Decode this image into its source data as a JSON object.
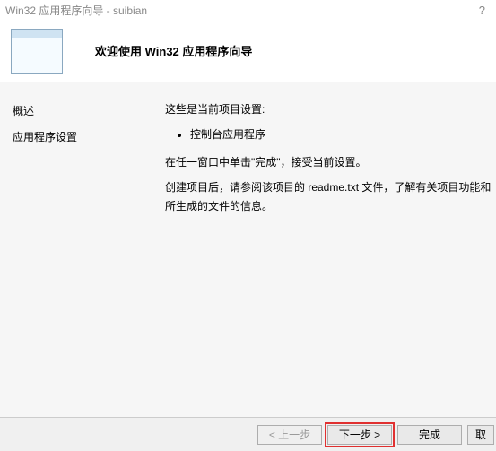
{
  "window": {
    "title": "Win32 应用程序向导 - suibian",
    "help_symbol": "?"
  },
  "header": {
    "title": "欢迎使用 Win32 应用程序向导"
  },
  "sidebar": {
    "items": [
      {
        "label": "概述"
      },
      {
        "label": "应用程序设置"
      }
    ]
  },
  "main": {
    "intro": "这些是当前项目设置:",
    "bullets": [
      "控制台应用程序"
    ],
    "line1": "在任一窗口中单击\"完成\"，接受当前设置。",
    "line2": "创建项目后，请参阅该项目的 readme.txt 文件，了解有关项目功能和所生成的文件的信息。"
  },
  "footer": {
    "prev": "< 上一步",
    "next": "下一步 >",
    "finish": "完成",
    "cancel": "取"
  }
}
